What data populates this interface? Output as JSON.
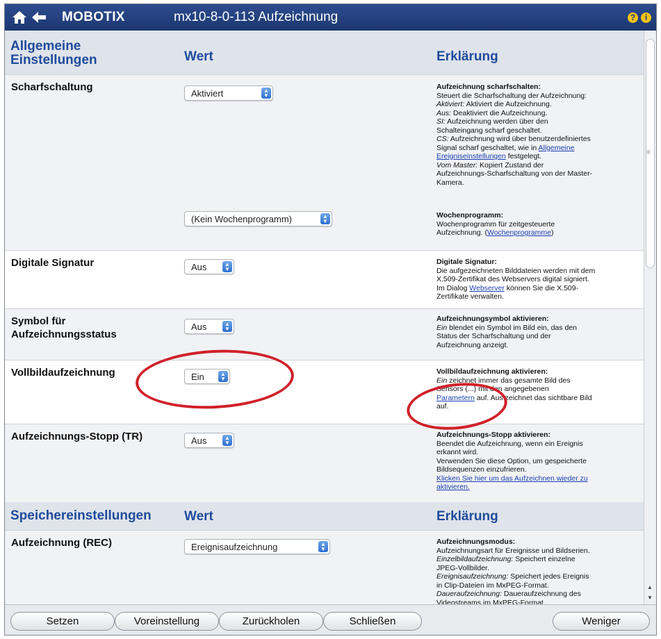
{
  "titlebar": {
    "brand": "MOBOTIX",
    "title": "mx10-8-0-113 Aufzeichnung",
    "help_glyph": "?",
    "info_glyph": "i"
  },
  "general": {
    "heading": [
      "Allgemeine",
      "Einstellungen"
    ],
    "col_value": "Wert",
    "col_expl": "Erklärung",
    "rows": [
      {
        "label": "Scharfschaltung",
        "select": "Aktiviert",
        "expl": [
          {
            "t": "Aufzeichnung scharfschalten:"
          },
          {
            "s": "Steuert die Scharfschaltung der Aufzeichnung:"
          },
          {
            "i": "Aktiviert:",
            "s": " Aktiviert die Aufzeichnung."
          },
          {
            "i": "Aus:",
            "s": " Deaktiviert die Aufzeichnung."
          },
          {
            "i": "SI:",
            "s": " Aufzeichnung werden über den"
          },
          {
            "s": "Schalteingang scharf geschaltet."
          },
          {
            "i": "CS:",
            "s": " Aufzeichnung wird über benutzerdefiniertes"
          },
          {
            "s": "Signal scharf geschaltet, wie in ",
            "l": "Allgemeine"
          },
          {
            "l": "Ereigniseinstellungen",
            "s": " festgelegt."
          },
          {
            "i": "Vom Master:",
            "s": " Kopiert Zustand der"
          },
          {
            "s": "Aufzeichnungs-Scharfschaltung von der Master-"
          },
          {
            "s": "Kamera."
          }
        ]
      },
      {
        "label": "",
        "select": "(Kein Wochenprogramm)",
        "expl": [
          {
            "t": "Wochenprogramm:"
          },
          {
            "s": "Wochenprogramm für zeitgesteuerte"
          },
          {
            "s": "Aufzeichnung. (",
            "l": "Wochenprogramme",
            "s2": ")"
          }
        ]
      },
      {
        "label": "Digitale Signatur",
        "select": "Aus",
        "expl": [
          {
            "t": "Digitale Signatur:"
          },
          {
            "s": "Die aufgezeichneten Bilddateien werden mit dem"
          },
          {
            "s": "X.509-Zertifikat des Webservers digital signiert."
          },
          {
            "s": "Im Dialog ",
            "l": "Webserver",
            "s2": " können Sie die X.509-"
          },
          {
            "s": "Zertifikate verwalten."
          }
        ]
      },
      {
        "label": [
          "Symbol für",
          "Aufzeichnungsstatus"
        ],
        "select": "Aus",
        "expl": [
          {
            "t": "Aufzeichnungsymbol aktivieren:"
          },
          {
            "i": "Ein",
            "s": " blendet ein Symbol im Bild ein, das den"
          },
          {
            "s": "Status der Scharfschaltung und der"
          },
          {
            "s": "Aufzeichnung anzeigt."
          }
        ]
      },
      {
        "label": "Vollbildaufzeichnung",
        "select": "Ein",
        "expl": [
          {
            "t": "Vollbildaufzeichnung aktivieren:"
          },
          {
            "i": "Ein",
            "s": " zeichnet immer das gesamte Bild des"
          },
          {
            "s": "Sensors (...) mit den angegebenen"
          },
          {
            "l": "Parametern",
            "s": " auf. Aus zeichnet das sichtbare Bild"
          },
          {
            "s": "auf."
          }
        ]
      },
      {
        "label": "Aufzeichnungs-Stopp (TR)",
        "select": "Aus",
        "expl": [
          {
            "t": "Aufzeichnungs-Stopp aktivieren:"
          },
          {
            "s": "Beendet die Aufzeichnung, wenn ein Ereignis"
          },
          {
            "s": "erkannt wird."
          },
          {
            "s": "Verwenden Sie diese Option, um gespeicherte"
          },
          {
            "s": "Bildsequenzen einzufrieren."
          },
          {
            "l": "Klicken Sie hier um das Aufzeichnen wieder zu"
          },
          {
            "l": "aktivieren."
          }
        ]
      }
    ]
  },
  "storage": {
    "heading": "Speichereinstellungen",
    "col_value": "Wert",
    "col_expl": "Erklärung",
    "rows": [
      {
        "label": "Aufzeichnung (REC)",
        "select": "Ereignisaufzeichnung",
        "expl": [
          {
            "t": "Aufzeichnungsmodus:"
          },
          {
            "s": "Aufzeichnungsart für Ereignisse und Bildserien."
          },
          {
            "i": "Einzelbildaufzeichnung:",
            "s": " Speichert einzelne"
          },
          {
            "s": "JPEG-Vollbilder."
          },
          {
            "i": "Ereignisaufzeichnung:",
            "s": " Speichert jedes Ereignis"
          },
          {
            "s": "in Clip-Dateien im MxPEG-Format."
          },
          {
            "i": "Daueraufzeichnung:",
            "s": " Daueraufzeichnung des"
          },
          {
            "s": "Videostreams im MxPEG-Format."
          }
        ]
      }
    ]
  },
  "buttons": {
    "set": "Setzen",
    "default": "Voreinstellung",
    "restore": "Zurückholen",
    "close": "Schließen",
    "less": "Weniger"
  },
  "colors": {
    "titlebar": "#1f3a78",
    "section_bg": "#dfe3ea",
    "heading_text": "#1f4b9c",
    "highlight_circle": "#d0212a",
    "select_arrow": "#2e6fd0"
  }
}
